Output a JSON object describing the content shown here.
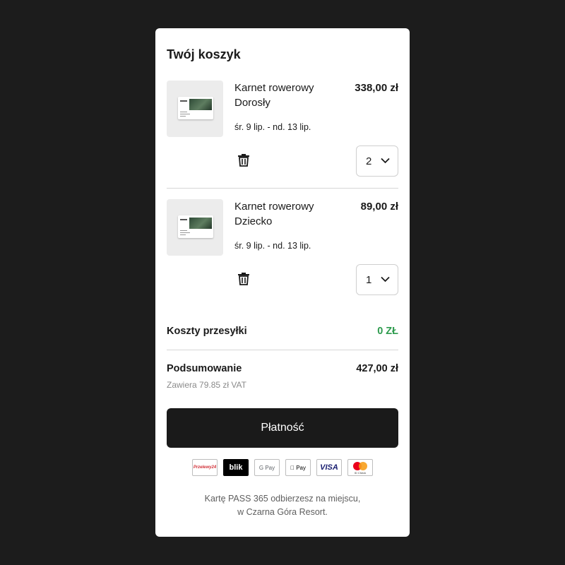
{
  "cart": {
    "title": "Twój koszyk",
    "items": [
      {
        "name": "Karnet rowerowy",
        "variant": "Dorosły",
        "price": "338,00 zł",
        "dates": "śr. 9 lip. - nd. 13 lip.",
        "quantity": "2"
      },
      {
        "name": "Karnet rowerowy",
        "variant": "Dziecko",
        "price": "89,00 zł",
        "dates": "śr. 9 lip. - nd. 13 lip.",
        "quantity": "1"
      }
    ],
    "shipping": {
      "label": "Koszty przesyłki",
      "value": "0 ZŁ",
      "color": "#2e9b4e"
    },
    "summary": {
      "label": "Podsumowanie",
      "value": "427,00 zł",
      "vat_note": "Zawiera 79.85 zł VAT"
    },
    "pay_button": "Płatność",
    "payment_methods": [
      {
        "name": "Przelewy24",
        "icon": "przelewy24-icon"
      },
      {
        "name": "blik",
        "icon": "blik-icon"
      },
      {
        "name": "G Pay",
        "icon": "google-pay-icon"
      },
      {
        "name": "Pay",
        "icon": "apple-pay-icon"
      },
      {
        "name": "VISA",
        "icon": "visa-icon"
      },
      {
        "name": "ID Check",
        "icon": "mastercard-icon"
      }
    ],
    "footer_line1": "Kartę PASS 365 odbierzesz na miejscu,",
    "footer_line2": "w Czarna Góra Resort."
  }
}
